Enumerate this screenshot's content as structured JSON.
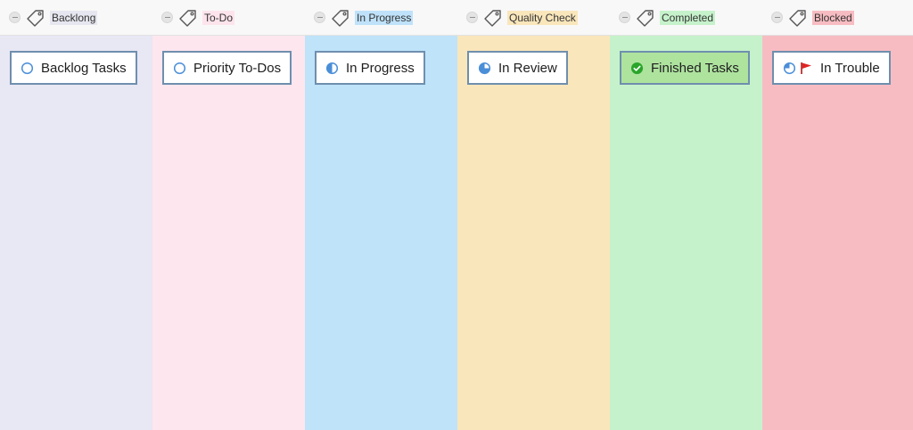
{
  "columns": [
    {
      "title": "Backlong",
      "title_bg": "#e6e6f0",
      "lane_color": "#e8e7f4",
      "card": {
        "label": "Backlog Tasks",
        "icon": "empty-circle-icon",
        "bg": "#ffffff"
      }
    },
    {
      "title": "To-Do",
      "title_bg": "#fde4ec",
      "lane_color": "#fde6ee",
      "card": {
        "label": "Priority To-Dos",
        "icon": "empty-circle-icon",
        "bg": "#ffffff"
      }
    },
    {
      "title": "In Progress",
      "title_bg": "#bfe2fa",
      "lane_color": "#bfe3f9",
      "card": {
        "label": "In Progress",
        "icon": "half-circle-icon",
        "bg": "#ffffff"
      }
    },
    {
      "title": "Quality Check",
      "title_bg": "#f9e6bb",
      "lane_color": "#f9e6bb",
      "card": {
        "label": "In Review",
        "icon": "three-quarter-circle-icon",
        "bg": "#ffffff"
      }
    },
    {
      "title": "Completed",
      "title_bg": "#c6f2cb",
      "lane_color": "#c6f2cb",
      "card": {
        "label": "Finished Tasks",
        "icon": "check-circle-icon",
        "bg": "#aee39e"
      }
    },
    {
      "title": "Blocked",
      "title_bg": "#f7bcc2",
      "lane_color": "#f7bcc2",
      "card": {
        "label": "In Trouble",
        "icon": "quarter-circle-icon",
        "flag_icon": "red-flag-icon",
        "bg": "#ffffff"
      }
    }
  ],
  "colors": {
    "card_border": "#6f8fae",
    "status_blue": "#4a8ed8",
    "check_green": "#2aa52a",
    "flag_red": "#e02424"
  }
}
